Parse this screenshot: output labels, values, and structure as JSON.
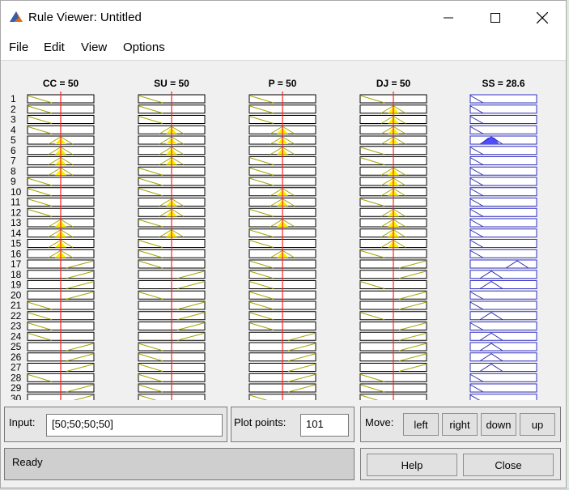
{
  "window": {
    "title": "Rule Viewer: Untitled",
    "controls": [
      "minimize-icon",
      "maximize-icon",
      "close-icon"
    ]
  },
  "menu": [
    "File",
    "Edit",
    "View",
    "Options"
  ],
  "viewer": {
    "columns": [
      {
        "title": "CC = 50",
        "value": 50,
        "type": "input"
      },
      {
        "title": "SU = 50",
        "value": 50,
        "type": "input"
      },
      {
        "title": "P = 50",
        "value": 50,
        "type": "input"
      },
      {
        "title": "DJ = 50",
        "value": 50,
        "type": "input"
      },
      {
        "title": "SS = 28.6",
        "value": 28.6,
        "type": "output"
      }
    ],
    "rule_numbers": [
      "1",
      "2",
      "3",
      "4",
      "5",
      "6",
      "7",
      "8",
      "9",
      "10",
      "11",
      "12",
      "13",
      "14",
      "15",
      "16",
      "17",
      "18",
      "19",
      "20",
      "21",
      "22",
      "23",
      "24",
      "25",
      "26",
      "27",
      "28",
      "29",
      "30"
    ],
    "rules": [
      [
        "L",
        "L",
        "L",
        "L",
        "L"
      ],
      [
        "L",
        "L",
        "L",
        "M",
        "L"
      ],
      [
        "L",
        "L",
        "L",
        "M",
        "L"
      ],
      [
        "L",
        "M",
        "M",
        "M",
        "L"
      ],
      [
        "M",
        "M",
        "M",
        "M",
        "M"
      ],
      [
        "M",
        "M",
        "M",
        "L",
        "L"
      ],
      [
        "M",
        "M",
        "L",
        "L",
        "L"
      ],
      [
        "M",
        "L",
        "L",
        "M",
        "L"
      ],
      [
        "L",
        "L",
        "L",
        "M",
        "L"
      ],
      [
        "L",
        "L",
        "M",
        "M",
        "L"
      ],
      [
        "L",
        "M",
        "M",
        "L",
        "L"
      ],
      [
        "L",
        "M",
        "L",
        "M",
        "L"
      ],
      [
        "M",
        "L",
        "M",
        "M",
        "L"
      ],
      [
        "M",
        "M",
        "L",
        "M",
        "L"
      ],
      [
        "M",
        "L",
        "L",
        "M",
        "L"
      ],
      [
        "M",
        "L",
        "M",
        "L",
        "L"
      ],
      [
        "H",
        "L",
        "L",
        "H",
        "H"
      ],
      [
        "H",
        "H",
        "L",
        "H",
        "M"
      ],
      [
        "H",
        "H",
        "L",
        "L",
        "M"
      ],
      [
        "H",
        "L",
        "L",
        "H",
        "L"
      ],
      [
        "L",
        "H",
        "L",
        "H",
        "L"
      ],
      [
        "L",
        "H",
        "L",
        "L",
        "M"
      ],
      [
        "L",
        "H",
        "L",
        "H",
        "L"
      ],
      [
        "L",
        "H",
        "H",
        "H",
        "M"
      ],
      [
        "H",
        "L",
        "H",
        "H",
        "M"
      ],
      [
        "H",
        "L",
        "H",
        "H",
        "M"
      ],
      [
        "H",
        "L",
        "H",
        "H",
        "M"
      ],
      [
        "L",
        "L",
        "H",
        "L",
        "L"
      ],
      [
        "H",
        "L",
        "H",
        "L",
        "L"
      ],
      [
        "H",
        "L",
        "L",
        "L",
        "L"
      ]
    ]
  },
  "controls": {
    "input_label": "Input:",
    "input_value": "[50;50;50;50]",
    "plot_points_label": "Plot points:",
    "plot_points_value": "101",
    "move_label": "Move:",
    "move_buttons": {
      "left": "left",
      "right": "right",
      "down": "down",
      "up": "up"
    },
    "status": "Ready",
    "help_label": "Help",
    "close_label": "Close"
  },
  "colors": {
    "input_mf_line": "#a3a300",
    "active_fill": "#ffee00",
    "output_mf_line": "#2a2aa8",
    "output_fill": "#4d4dff",
    "input_line": "#ff2020",
    "box_border_input": "#000000",
    "box_border_output": "#3030c0"
  }
}
